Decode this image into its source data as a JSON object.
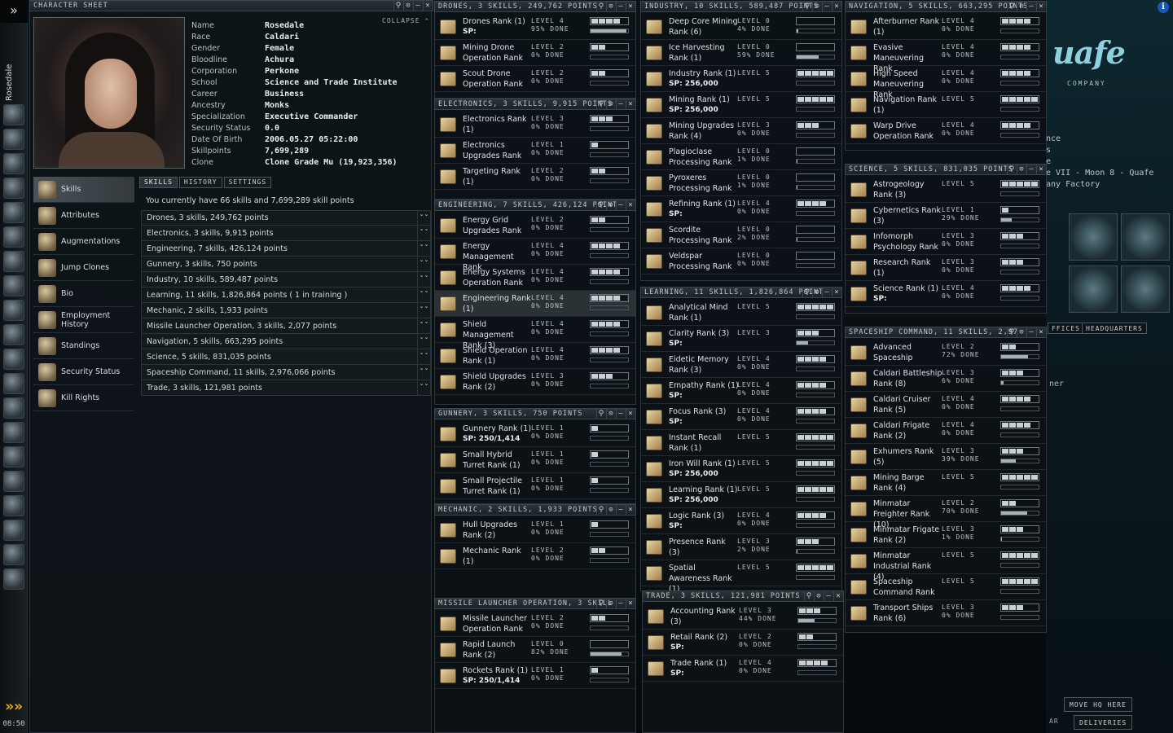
{
  "neocom": {
    "charname": "Rosedale",
    "clock": "08:50",
    "top_arrow": "»",
    "bottom_chevron": "»»",
    "icons": [
      "character-sheet-icon",
      "skills-icon",
      "mail-icon",
      "notepad-icon",
      "market-icon",
      "assets-icon",
      "contracts-icon",
      "map-icon",
      "starmap-icon",
      "corporation-icon",
      "science-icon",
      "calculator-icon",
      "help-icon",
      "people-icon",
      "journal-icon",
      "music-icon",
      "info-icon",
      "portrait-icon",
      "ships-icon",
      "items-icon"
    ]
  },
  "station": {
    "logo": "uafe",
    "company": "COMPANY",
    "lines": [
      "nce",
      "s",
      "e",
      "e VII - Moon 8 - Quafe",
      "any Factory"
    ],
    "tab_offices": "FFICES",
    "tab_hq": "HEADQUARTERS",
    "btn_move_hq": "MOVE HQ HERE",
    "btn_deliveries": "DELIVERIES",
    "side_text": "ner",
    "frag_ar": "AR"
  },
  "charsheet": {
    "title": "CHARACTER SHEET",
    "collapse": "COLLAPSE",
    "info": [
      {
        "k": "Name",
        "v": "Rosedale"
      },
      {
        "k": "Race",
        "v": "Caldari"
      },
      {
        "k": "Gender",
        "v": "Female"
      },
      {
        "k": "Bloodline",
        "v": "Achura"
      },
      {
        "k": "Corporation",
        "v": "Perkone"
      },
      {
        "k": "School",
        "v": "Science and Trade Institute"
      },
      {
        "k": "Career",
        "v": "Business"
      },
      {
        "k": "Ancestry",
        "v": "Monks"
      },
      {
        "k": "Specialization",
        "v": "Executive Commander"
      },
      {
        "k": "Security Status",
        "v": "0.0"
      },
      {
        "k": "Date Of Birth",
        "v": "2006.05.27 05:22:00"
      },
      {
        "k": "Skillpoints",
        "v": "7,699,289"
      },
      {
        "k": "Clone",
        "v": "Clone Grade Mu (19,923,356)"
      }
    ],
    "nav": [
      "Skills",
      "Attributes",
      "Augmentations",
      "Jump Clones",
      "Bio",
      "Employment History",
      "Standings",
      "Security Status",
      "Kill Rights"
    ],
    "tabs": [
      "SKILLS",
      "HISTORY",
      "SETTINGS"
    ],
    "summary": "You currently have 66 skills and 7,699,289 skill points",
    "groups": [
      "Drones, 3 skills, 249,762 points",
      "Electronics, 3 skills, 9,915 points",
      "Engineering, 7 skills, 426,124 points",
      "Gunnery, 3 skills, 750 points",
      "Industry, 10 skills, 589,487 points",
      "Learning, 11 skills, 1,826,864 points ( 1 in training )",
      "Mechanic, 2 skills, 1,933 points",
      "Missile Launcher Operation, 3 skills, 2,077 points",
      "Navigation, 5 skills, 663,295 points",
      "Science, 5 skills, 831,035 points",
      "Spaceship Command, 11 skills, 2,976,066 points",
      "Trade, 3 skills, 121,981 points"
    ]
  },
  "windows": {
    "drones": {
      "title": "DRONES, 3 SKILLS, 249,762 POINTS",
      "skills": [
        {
          "name": "Drones Rank (1)",
          "sp": "SP:",
          "lvl": "LEVEL 4",
          "done": "95% DONE",
          "level": 4,
          "progress": 0.95
        },
        {
          "name": "Mining Drone Operation Rank",
          "lvl": "LEVEL 2",
          "done": "0% DONE",
          "level": 2,
          "progress": 0
        },
        {
          "name": "Scout Drone Operation Rank",
          "lvl": "LEVEL 2",
          "done": "0% DONE",
          "level": 2,
          "progress": 0
        }
      ]
    },
    "electronics": {
      "title": "ELECTRONICS, 3 SKILLS, 9,915 POINTS",
      "skills": [
        {
          "name": "Electronics Rank (1)",
          "lvl": "LEVEL 3",
          "done": "0% DONE",
          "level": 3,
          "progress": 0
        },
        {
          "name": "Electronics Upgrades Rank",
          "lvl": "LEVEL 1",
          "done": "0% DONE",
          "level": 1,
          "progress": 0
        },
        {
          "name": "Targeting Rank (1)",
          "lvl": "LEVEL 2",
          "done": "0% DONE",
          "level": 2,
          "progress": 0
        }
      ]
    },
    "engineering": {
      "title": "ENGINEERING, 7 SKILLS, 426,124 POINT",
      "skills": [
        {
          "name": "Energy Grid Upgrades Rank",
          "lvl": "LEVEL 2",
          "done": "0% DONE",
          "level": 2,
          "progress": 0
        },
        {
          "name": "Energy Management Rank",
          "lvl": "LEVEL 4",
          "done": "0% DONE",
          "level": 4,
          "progress": 0
        },
        {
          "name": "Energy Systems Operation Rank",
          "lvl": "LEVEL 4",
          "done": "0% DONE",
          "level": 4,
          "progress": 0
        },
        {
          "name": "Engineering Rank (1)",
          "lvl": "LEVEL 4",
          "done": "0% DONE",
          "level": 4,
          "progress": 0,
          "hl": true
        },
        {
          "name": "Shield Management Rank (3)",
          "lvl": "LEVEL 4",
          "done": "0% DONE",
          "level": 4,
          "progress": 0
        },
        {
          "name": "Shield Operation Rank (1)",
          "lvl": "LEVEL 4",
          "done": "0% DONE",
          "level": 4,
          "progress": 0
        },
        {
          "name": "Shield Upgrades Rank (2)",
          "lvl": "LEVEL 3",
          "done": "0% DONE",
          "level": 3,
          "progress": 0
        }
      ]
    },
    "gunnery": {
      "title": "GUNNERY, 3 SKILLS, 750 POINTS",
      "skills": [
        {
          "name": "Gunnery Rank (1)",
          "sp": "SP: 250/1,414",
          "lvl": "LEVEL 1",
          "done": "0% DONE",
          "level": 1,
          "progress": 0
        },
        {
          "name": "Small Hybrid Turret Rank (1)",
          "lvl": "LEVEL 1",
          "done": "0% DONE",
          "level": 1,
          "progress": 0
        },
        {
          "name": "Small Projectile Turret Rank (1)",
          "lvl": "LEVEL 1",
          "done": "0% DONE",
          "level": 1,
          "progress": 0
        }
      ]
    },
    "mechanic": {
      "title": "MECHANIC, 2 SKILLS, 1,933 POINTS",
      "skills": [
        {
          "name": "Hull Upgrades Rank (2)",
          "lvl": "LEVEL 1",
          "done": "0% DONE",
          "level": 1,
          "progress": 0
        },
        {
          "name": "Mechanic Rank (1)",
          "lvl": "LEVEL 2",
          "done": "0% DONE",
          "level": 2,
          "progress": 0
        }
      ]
    },
    "missile": {
      "title": "MISSILE LAUNCHER OPERATION, 3 SKILL",
      "skills": [
        {
          "name": "Missile Launcher Operation Rank",
          "lvl": "LEVEL 2",
          "done": "0% DONE",
          "level": 2,
          "progress": 0
        },
        {
          "name": "Rapid Launch Rank (2)",
          "lvl": "LEVEL 0",
          "done": "82% DONE",
          "level": 0,
          "progress": 0.82
        },
        {
          "name": "Rockets Rank (1)",
          "sp": "SP: 250/1,414",
          "lvl": "LEVEL 1",
          "done": "0% DONE",
          "level": 1,
          "progress": 0
        }
      ]
    },
    "industry": {
      "title": "INDUSTRY, 10 SKILLS, 589,487 POINTS",
      "skills": [
        {
          "name": "Deep Core Mining Rank (6)",
          "lvl": "LEVEL 0",
          "done": "4% DONE",
          "level": 0,
          "progress": 0.04
        },
        {
          "name": "Ice Harvesting Rank (1)",
          "lvl": "LEVEL 0",
          "done": "59% DONE",
          "level": 0,
          "progress": 0.59
        },
        {
          "name": "Industry Rank (1)",
          "sp": "SP: 256,000",
          "lvl": "LEVEL 5",
          "level": 5,
          "progress": 0
        },
        {
          "name": "Mining Rank (1)",
          "sp": "SP: 256,000",
          "lvl": "LEVEL 5",
          "level": 5,
          "progress": 0
        },
        {
          "name": "Mining Upgrades Rank (4)",
          "lvl": "LEVEL 3",
          "done": "0% DONE",
          "level": 3,
          "progress": 0
        },
        {
          "name": "Plagioclase Processing Rank",
          "lvl": "LEVEL 0",
          "done": "1% DONE",
          "level": 0,
          "progress": 0.01
        },
        {
          "name": "Pyroxeres Processing Rank",
          "lvl": "LEVEL 0",
          "done": "1% DONE",
          "level": 0,
          "progress": 0.01
        },
        {
          "name": "Refining Rank (1)",
          "sp": "SP:",
          "lvl": "LEVEL 4",
          "done": "0% DONE",
          "level": 4,
          "progress": 0
        },
        {
          "name": "Scordite Processing Rank",
          "lvl": "LEVEL 0",
          "done": "2% DONE",
          "level": 0,
          "progress": 0.02
        },
        {
          "name": "Veldspar Processing Rank",
          "lvl": "LEVEL 0",
          "done": "0% DONE",
          "level": 0,
          "progress": 0
        }
      ]
    },
    "learning": {
      "title": "LEARNING, 11 SKILLS, 1,826,864 POINT",
      "skills": [
        {
          "name": "Analytical Mind Rank (1)",
          "lvl": "LEVEL 5",
          "level": 5,
          "progress": 0
        },
        {
          "name": "Clarity Rank (3)",
          "sp": "SP:",
          "lvl": "LEVEL 3",
          "level": 3,
          "progress": 0.3
        },
        {
          "name": "Eidetic Memory Rank (3)",
          "lvl": "LEVEL 4",
          "done": "0% DONE",
          "level": 4,
          "progress": 0
        },
        {
          "name": "Empathy Rank (1)",
          "sp": "SP:",
          "lvl": "LEVEL 4",
          "done": "0% DONE",
          "level": 4,
          "progress": 0
        },
        {
          "name": "Focus Rank (3)",
          "sp": "SP:",
          "lvl": "LEVEL 4",
          "done": "0% DONE",
          "level": 4,
          "progress": 0
        },
        {
          "name": "Instant Recall Rank (1)",
          "lvl": "LEVEL 5",
          "level": 5,
          "progress": 0
        },
        {
          "name": "Iron Will Rank (1)",
          "sp": "SP: 256,000",
          "lvl": "LEVEL 5",
          "level": 5,
          "progress": 0
        },
        {
          "name": "Learning Rank (1)",
          "sp": "SP: 256,000",
          "lvl": "LEVEL 5",
          "level": 5,
          "progress": 0
        },
        {
          "name": "Logic Rank (3)",
          "sp": "SP:",
          "lvl": "LEVEL 4",
          "done": "0% DONE",
          "level": 4,
          "progress": 0
        },
        {
          "name": "Presence Rank (3)",
          "lvl": "LEVEL 3",
          "done": "2% DONE",
          "level": 3,
          "progress": 0.02
        },
        {
          "name": "Spatial Awareness Rank (1)",
          "lvl": "LEVEL 5",
          "level": 5,
          "progress": 0
        }
      ]
    },
    "trade": {
      "title": "TRADE, 3 SKILLS, 121,981 POINTS",
      "skills": [
        {
          "name": "Accounting Rank (3)",
          "lvl": "LEVEL 3",
          "done": "44% DONE",
          "level": 3,
          "progress": 0.44
        },
        {
          "name": "Retail Rank (2)",
          "sp": "SP:",
          "lvl": "LEVEL 2",
          "done": "0% DONE",
          "level": 2,
          "progress": 0
        },
        {
          "name": "Trade Rank (1)",
          "sp": "SP:",
          "lvl": "LEVEL 4",
          "done": "0% DONE",
          "level": 4,
          "progress": 0
        }
      ]
    },
    "navigation": {
      "title": "NAVIGATION, 5 SKILLS, 663,295 POINTS",
      "skills": [
        {
          "name": "Afterburner Rank (1)",
          "lvl": "LEVEL 4",
          "done": "0% DONE",
          "level": 4,
          "progress": 0
        },
        {
          "name": "Evasive Maneuvering Rank",
          "lvl": "LEVEL 4",
          "done": "0% DONE",
          "level": 4,
          "progress": 0
        },
        {
          "name": "High Speed Maneuvering Rank",
          "lvl": "LEVEL 4",
          "done": "0% DONE",
          "level": 4,
          "progress": 0
        },
        {
          "name": "Navigation Rank (1)",
          "lvl": "LEVEL 5",
          "level": 5,
          "progress": 0
        },
        {
          "name": "Warp Drive Operation Rank",
          "lvl": "LEVEL 4",
          "done": "0% DONE",
          "level": 4,
          "progress": 0
        }
      ]
    },
    "science": {
      "title": "SCIENCE, 5 SKILLS, 831,035 POINTS",
      "skills": [
        {
          "name": "Astrogeology Rank (3)",
          "lvl": "LEVEL 5",
          "level": 5,
          "progress": 0
        },
        {
          "name": "Cybernetics Rank (3)",
          "lvl": "LEVEL 1",
          "done": "29% DONE",
          "level": 1,
          "progress": 0.29
        },
        {
          "name": "Infomorph Psychology Rank",
          "lvl": "LEVEL 3",
          "done": "0% DONE",
          "level": 3,
          "progress": 0
        },
        {
          "name": "Research Rank (1)",
          "lvl": "LEVEL 3",
          "done": "0% DONE",
          "level": 3,
          "progress": 0
        },
        {
          "name": "Science Rank (1)",
          "sp": "SP:",
          "lvl": "LEVEL 4",
          "done": "0% DONE",
          "level": 4,
          "progress": 0
        }
      ]
    },
    "spaceship": {
      "title": "SPACESHIP COMMAND, 11 SKILLS, 2,97",
      "skills": [
        {
          "name": "Advanced Spaceship",
          "lvl": "LEVEL 2",
          "done": "72% DONE",
          "level": 2,
          "progress": 0.72
        },
        {
          "name": "Caldari Battleship Rank (8)",
          "lvl": "LEVEL 3",
          "done": "6% DONE",
          "level": 3,
          "progress": 0.06
        },
        {
          "name": "Caldari Cruiser Rank (5)",
          "lvl": "LEVEL 4",
          "done": "0% DONE",
          "level": 4,
          "progress": 0
        },
        {
          "name": "Caldari Frigate Rank (2)",
          "lvl": "LEVEL 4",
          "done": "0% DONE",
          "level": 4,
          "progress": 0
        },
        {
          "name": "Exhumers Rank (5)",
          "lvl": "LEVEL 3",
          "done": "39% DONE",
          "level": 3,
          "progress": 0.39
        },
        {
          "name": "Mining Barge Rank (4)",
          "lvl": "LEVEL 5",
          "level": 5,
          "progress": 0
        },
        {
          "name": "Minmatar Freighter Rank (10)",
          "lvl": "LEVEL 2",
          "done": "70% DONE",
          "level": 2,
          "progress": 0.7
        },
        {
          "name": "Minmatar Frigate Rank (2)",
          "lvl": "LEVEL 3",
          "done": "1% DONE",
          "level": 3,
          "progress": 0.01
        },
        {
          "name": "Minmatar Industrial Rank (4)",
          "lvl": "LEVEL 5",
          "level": 5,
          "progress": 0
        },
        {
          "name": "Spaceship Command Rank",
          "lvl": "LEVEL 5",
          "level": 5,
          "progress": 0
        },
        {
          "name": "Transport Ships Rank (6)",
          "lvl": "LEVEL 3",
          "done": "0% DONE",
          "level": 3,
          "progress": 0
        }
      ]
    }
  }
}
